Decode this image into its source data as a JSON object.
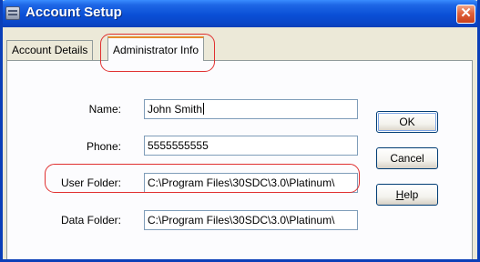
{
  "window": {
    "title": "Account Setup"
  },
  "titlebar": {
    "close_symbol": "✕",
    "icon_name": "app-icon"
  },
  "tabs": [
    {
      "label": "Account Details",
      "active": false
    },
    {
      "label": "Administrator Info",
      "active": true
    }
  ],
  "form": {
    "name": {
      "label": "Name:",
      "value": "John Smith"
    },
    "phone": {
      "label": "Phone:",
      "value": "5555555555"
    },
    "user_folder": {
      "label": "User Folder:",
      "value": "C:\\Program Files\\30SDC\\3.0\\Platinum\\"
    },
    "data_folder": {
      "label": "Data Folder:",
      "value": "C:\\Program Files\\30SDC\\3.0\\Platinum\\"
    }
  },
  "buttons": {
    "ok": "OK",
    "cancel": "Cancel",
    "help_hotkey": "H",
    "help_rest": "elp"
  },
  "colors": {
    "titlebar": "#0a4fd6",
    "highlight": "#e03030",
    "tab_accent": "#e68b2c",
    "dialog_bg": "#ece9d8"
  }
}
